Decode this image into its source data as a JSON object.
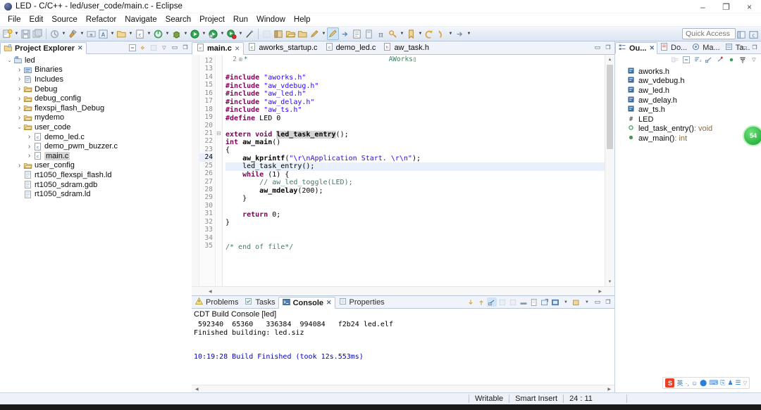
{
  "window": {
    "title": "LED - C/C++ - led/user_code/main.c - Eclipse",
    "minimize": "–",
    "maximize": "❐",
    "close": "×"
  },
  "menubar": {
    "items": [
      "File",
      "Edit",
      "Source",
      "Refactor",
      "Navigate",
      "Search",
      "Project",
      "Run",
      "Window",
      "Help"
    ]
  },
  "toolbar": {
    "quick_access_placeholder": "Quick Access",
    "buttons": [
      {
        "name": "new-wizard",
        "glyph": "new"
      },
      {
        "name": "save",
        "glyph": "save"
      },
      {
        "name": "save-all",
        "glyph": "saveall"
      },
      {
        "name": "print",
        "glyph": "print"
      },
      {
        "name": "build-all",
        "glyph": "hammer"
      },
      {
        "name": "new-c-project",
        "glyph": "c"
      },
      {
        "name": "open-element",
        "glyph": "open"
      },
      {
        "name": "search",
        "glyph": "search"
      },
      {
        "name": "debug",
        "glyph": "bug"
      },
      {
        "name": "run",
        "glyph": "run"
      },
      {
        "name": "external-tools",
        "glyph": "ext"
      },
      {
        "name": "profile",
        "glyph": "profile"
      },
      {
        "name": "skip-breakpoints",
        "glyph": "skip"
      }
    ]
  },
  "project_explorer": {
    "tab_label": "Project Explorer",
    "tree": [
      {
        "label": "led",
        "indent": 0,
        "twist": "open",
        "icon": "project"
      },
      {
        "label": "Binaries",
        "indent": 1,
        "twist": "closed",
        "icon": "binaries"
      },
      {
        "label": "Includes",
        "indent": 1,
        "twist": "closed",
        "icon": "includes"
      },
      {
        "label": "Debug",
        "indent": 1,
        "twist": "closed",
        "icon": "folder"
      },
      {
        "label": "debug_config",
        "indent": 1,
        "twist": "closed",
        "icon": "folder"
      },
      {
        "label": "flexspi_flash_Debug",
        "indent": 1,
        "twist": "closed",
        "icon": "folder"
      },
      {
        "label": "mydemo",
        "indent": 1,
        "twist": "closed",
        "icon": "folder"
      },
      {
        "label": "user_code",
        "indent": 1,
        "twist": "open",
        "icon": "folder"
      },
      {
        "label": "demo_led.c",
        "indent": 2,
        "twist": "closed",
        "icon": "cfile"
      },
      {
        "label": "demo_pwm_buzzer.c",
        "indent": 2,
        "twist": "closed",
        "icon": "cfile"
      },
      {
        "label": "main.c",
        "indent": 2,
        "twist": "closed",
        "icon": "cfile",
        "selected": true
      },
      {
        "label": "user_config",
        "indent": 1,
        "twist": "closed",
        "icon": "folder"
      },
      {
        "label": "rt1050_flexspi_flash.ld",
        "indent": 1,
        "twist": "none",
        "icon": "file"
      },
      {
        "label": "rt1050_sdram.gdb",
        "indent": 1,
        "twist": "none",
        "icon": "file"
      },
      {
        "label": "rt1050_sdram.ld",
        "indent": 1,
        "twist": "none",
        "icon": "file"
      }
    ]
  },
  "editor": {
    "tabs": [
      {
        "label": "main.c",
        "icon": "cfile",
        "selected": true,
        "close": "⌧"
      },
      {
        "label": "aworks_startup.c",
        "icon": "cfile2",
        "selected": false
      },
      {
        "label": "demo_led.c",
        "icon": "cfile",
        "selected": false
      },
      {
        "label": "aw_task.h",
        "icon": "hfile",
        "selected": false
      }
    ],
    "fold_header": {
      "line_no": "2",
      "text": "AWorks"
    },
    "first_line": 12,
    "highlighted_line": 24,
    "lines": [
      {
        "n": 12,
        "segs": []
      },
      {
        "n": 13,
        "segs": [
          {
            "t": "#include ",
            "c": "pre"
          },
          {
            "t": "\"aworks.h\"",
            "c": "str"
          }
        ]
      },
      {
        "n": 14,
        "segs": [
          {
            "t": "#include ",
            "c": "pre"
          },
          {
            "t": "\"aw_vdebug.h\"",
            "c": "str"
          }
        ]
      },
      {
        "n": 15,
        "segs": [
          {
            "t": "#include ",
            "c": "pre"
          },
          {
            "t": "\"aw_led.h\"",
            "c": "str"
          }
        ]
      },
      {
        "n": 16,
        "segs": [
          {
            "t": "#include ",
            "c": "pre"
          },
          {
            "t": "\"aw_delay.h\"",
            "c": "str"
          }
        ]
      },
      {
        "n": 17,
        "segs": [
          {
            "t": "#include ",
            "c": "pre"
          },
          {
            "t": "\"aw_ts.h\"",
            "c": "str"
          }
        ]
      },
      {
        "n": 18,
        "segs": [
          {
            "t": "#define ",
            "c": "pre"
          },
          {
            "t": "LED 0",
            "c": ""
          }
        ]
      },
      {
        "n": 19,
        "segs": []
      },
      {
        "n": 20,
        "segs": [
          {
            "t": "extern void ",
            "c": "kw"
          },
          {
            "t": "led_task_entry",
            "c": "fn-def"
          },
          {
            "t": "();",
            "c": ""
          }
        ]
      },
      {
        "n": 21,
        "segs": [
          {
            "t": "int ",
            "c": "kw"
          },
          {
            "t": "aw_main",
            "c": "bold"
          },
          {
            "t": "()",
            "c": ""
          }
        ],
        "fold": "collapse"
      },
      {
        "n": 22,
        "segs": [
          {
            "t": "{",
            "c": ""
          }
        ]
      },
      {
        "n": 23,
        "segs": [
          {
            "t": "    ",
            "c": ""
          },
          {
            "t": "aw_kprintf",
            "c": "bold"
          },
          {
            "t": "(",
            "c": ""
          },
          {
            "t": "\"\\r\\nApplication Start. \\r\\n\"",
            "c": "str"
          },
          {
            "t": ");",
            "c": ""
          }
        ]
      },
      {
        "n": 24,
        "segs": [
          {
            "t": "    led_task_entry();",
            "c": ""
          }
        ],
        "hl": true
      },
      {
        "n": 25,
        "segs": [
          {
            "t": "    ",
            "c": ""
          },
          {
            "t": "while ",
            "c": "kw"
          },
          {
            "t": "(1) {",
            "c": ""
          }
        ]
      },
      {
        "n": 26,
        "segs": [
          {
            "t": "        ",
            "c": ""
          },
          {
            "t": "// aw_led_toggle(LED);",
            "c": "cmt"
          }
        ]
      },
      {
        "n": 27,
        "segs": [
          {
            "t": "        ",
            "c": ""
          },
          {
            "t": "aw_mdelay",
            "c": "bold"
          },
          {
            "t": "(200);",
            "c": ""
          }
        ]
      },
      {
        "n": 28,
        "segs": [
          {
            "t": "    }",
            "c": ""
          }
        ]
      },
      {
        "n": 29,
        "segs": []
      },
      {
        "n": 30,
        "segs": [
          {
            "t": "    ",
            "c": ""
          },
          {
            "t": "return ",
            "c": "kw"
          },
          {
            "t": "0;",
            "c": ""
          }
        ]
      },
      {
        "n": 31,
        "segs": [
          {
            "t": "}",
            "c": ""
          }
        ]
      },
      {
        "n": 32,
        "segs": []
      },
      {
        "n": 33,
        "segs": []
      },
      {
        "n": 34,
        "segs": [
          {
            "t": "/* end of file*/",
            "c": "cmt"
          }
        ]
      },
      {
        "n": 35,
        "segs": []
      }
    ]
  },
  "console": {
    "tabs": [
      {
        "label": "Problems",
        "icon": "problems",
        "selected": false
      },
      {
        "label": "Tasks",
        "icon": "tasks",
        "selected": false
      },
      {
        "label": "Console",
        "icon": "console",
        "selected": true,
        "close": "⌧"
      },
      {
        "label": "Properties",
        "icon": "properties",
        "selected": false
      }
    ],
    "title": "CDT Build Console [led]",
    "lines": [
      {
        "text": " 592340\t 65360\t 336384\t 994084\t  f2b24 led.elf",
        "style": "plain"
      },
      {
        "text": "Finished building: led.siz",
        "style": "plain"
      },
      {
        "text": "",
        "style": "plain"
      },
      {
        "text": "",
        "style": "plain"
      },
      {
        "text": "10:19:28 Build Finished (took 12s.553ms)",
        "style": "blue"
      }
    ]
  },
  "outline": {
    "tabs": [
      {
        "label": "Ou...",
        "icon": "outline",
        "selected": true,
        "close": "⌧"
      },
      {
        "label": "Do...",
        "icon": "docs",
        "selected": false
      },
      {
        "label": "Ma...",
        "icon": "make",
        "selected": false
      },
      {
        "label": "Ta...",
        "icon": "targets",
        "selected": false
      }
    ],
    "items": [
      {
        "label": "aworks.h",
        "icon": "include",
        "ret": ""
      },
      {
        "label": "aw_vdebug.h",
        "icon": "include",
        "ret": ""
      },
      {
        "label": "aw_led.h",
        "icon": "include",
        "ret": ""
      },
      {
        "label": "aw_delay.h",
        "icon": "include",
        "ret": ""
      },
      {
        "label": "aw_ts.h",
        "icon": "include",
        "ret": ""
      },
      {
        "label": "LED",
        "icon": "define",
        "ret": ""
      },
      {
        "label": "led_task_entry()",
        "icon": "method-proto",
        "ret": " : void"
      },
      {
        "label": "aw_main()",
        "icon": "method",
        "ret": " : int"
      }
    ]
  },
  "statusbar": {
    "writable": "Writable",
    "insert_mode": "Smart Insert",
    "position": "24 : 11"
  },
  "floating": {
    "circle_label": "54"
  },
  "ime": {
    "logo": "S",
    "items": [
      "英",
      "·,",
      "☺",
      "⬤",
      "⌨",
      "⎘",
      "♟",
      "☰"
    ]
  },
  "colors": {
    "accent": "#2b7fd4",
    "keyword": "#7f0055",
    "string": "#2a00ff",
    "comment": "#3f7f5f",
    "console_blue": "#0000c0",
    "chrome": "#dde6f2"
  }
}
